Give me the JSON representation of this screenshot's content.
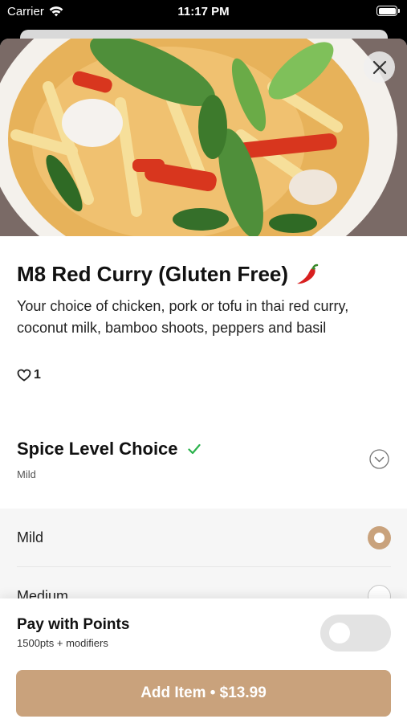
{
  "status_bar": {
    "carrier": "Carrier",
    "time": "11:17 PM",
    "icons": [
      "wifi-icon",
      "battery-icon"
    ]
  },
  "item": {
    "title": "M8 Red Curry (Gluten Free)",
    "title_icon": "chili-pepper-icon",
    "description": "Your choice of chicken, pork or tofu in thai red curry, coconut milk, bamboo shoots, peppers and basil",
    "likes": "1",
    "image": "red-curry-photo"
  },
  "spice_section": {
    "title": "Spice Level Choice",
    "selected": "Mild",
    "complete_icon": "checkmark-icon",
    "collapse_icon": "chevron-down-circle-icon",
    "options": [
      {
        "label": "Mild",
        "selected": true
      },
      {
        "label": "Medium",
        "selected": false
      }
    ]
  },
  "points": {
    "title": "Pay with Points",
    "subtitle": "1500pts + modifiers",
    "enabled": false
  },
  "add_button": {
    "label": "Add Item • $13.99"
  },
  "colors": {
    "accent": "#c9a27c",
    "check": "#2bb24c",
    "chili": "#d81f1f"
  }
}
